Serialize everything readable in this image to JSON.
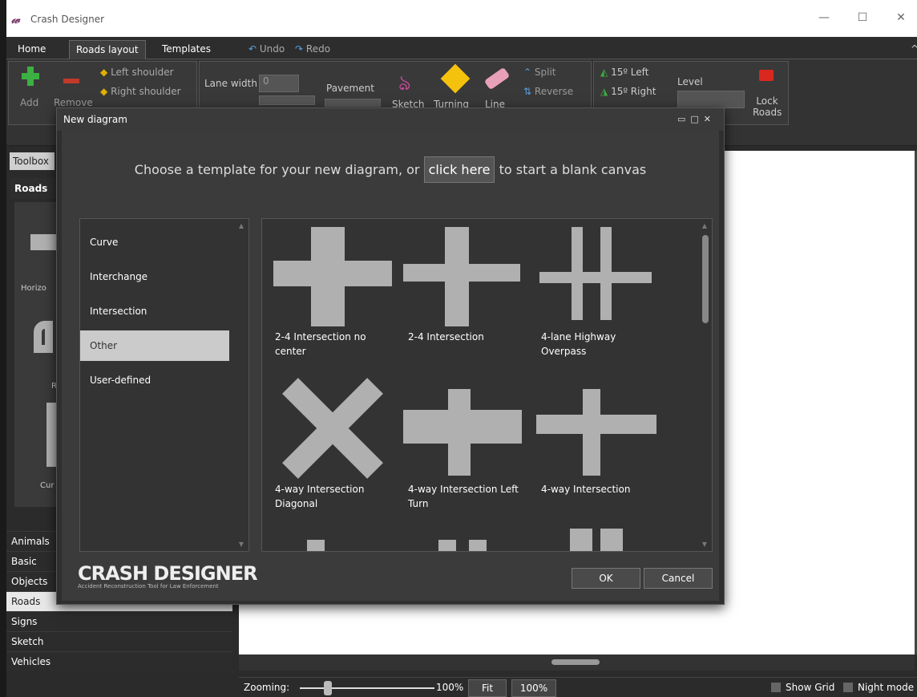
{
  "window": {
    "title": "Crash Designer",
    "logo_glyph": "𝓌",
    "min": "—",
    "max": "☐",
    "close": "✕"
  },
  "menu": {
    "home": "Home",
    "roads_layout": "Roads layout",
    "templates": "Templates",
    "undo": "Undo",
    "redo": "Redo",
    "collapse": "^"
  },
  "ribbon": {
    "add": "Add",
    "remove": "Remove",
    "left_shoulder": "Left shoulder",
    "right_shoulder": "Right shoulder",
    "lane_width": "Lane width",
    "lane_width_value": "0",
    "pavement": "Pavement",
    "sketch": "Sketch",
    "turning": "Turning",
    "line": "Line",
    "split": "Split",
    "reverse": "Reverse",
    "left15": "15º Left",
    "right15": "15º Right",
    "level": "Level",
    "lock_roads": "Lock Roads"
  },
  "dialog": {
    "title": "New diagram",
    "prompt_pre": "Choose a template for your new diagram, or",
    "prompt_link": "click here",
    "prompt_post": "to start a blank canvas",
    "categories": [
      "Curve",
      "Interchange",
      "Intersection",
      "Other",
      "User-defined"
    ],
    "selected_category": "Other",
    "templates": [
      "2-4 Intersection no center",
      "2-4 Intersection",
      "4-lane Highway Overpass",
      "4-way Intersection Diagonal",
      "4-way Intersection Left Turn",
      "4-way Intersection"
    ],
    "brand_name": "CRASH DESIGNER",
    "brand_tagline": "Accident Reconstruction Tool for Law Enforcement",
    "ok": "OK",
    "cancel": "Cancel"
  },
  "toolbox": {
    "tab": "Toolbox",
    "heading": "Roads",
    "partial_labels": [
      "Horizo",
      "R",
      "Cur"
    ],
    "categories": [
      "Animals",
      "Basic",
      "Objects",
      "Roads",
      "Signs",
      "Sketch",
      "Vehicles"
    ],
    "selected": "Roads"
  },
  "status": {
    "zooming": "Zooming:",
    "zoom_value": "100%",
    "zoom_fraction": 0.2,
    "fit": "Fit",
    "zoom_100": "100%",
    "show_grid": "Show Grid",
    "night_mode": "Night mode"
  },
  "colors": {
    "add": "#3cb043",
    "remove": "#c0392b",
    "turning": "#f4c20d",
    "lock": "#d9281e",
    "accent": "#b0b0b0"
  }
}
